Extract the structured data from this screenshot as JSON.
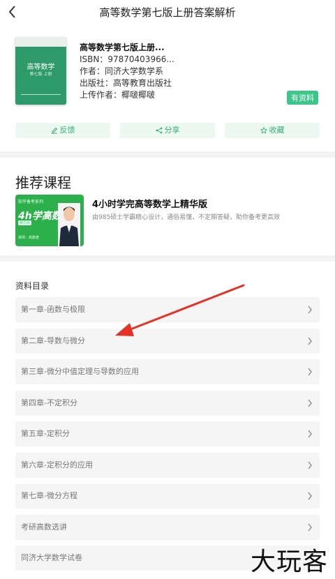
{
  "header": {
    "title": "高等数学第七版上册答案解析"
  },
  "book": {
    "cover_title": "高等数学",
    "cover_subtitle": "第七版 上册",
    "title": "高等数学第七版上册...",
    "isbn": "ISBN：97870403966...",
    "author": "作者：同济大学数学系",
    "publisher": "出版社：高等教育出版社",
    "uploader": "上传作者：椰啵椰啵",
    "badge": "有资料"
  },
  "actions": [
    {
      "label": "反馈",
      "icon": "edit-icon"
    },
    {
      "label": "分享",
      "icon": "share-icon"
    },
    {
      "label": "收藏",
      "icon": "star-icon"
    }
  ],
  "recommend": {
    "section_title": "推荐课程",
    "course_title": "4小时学完高等数学上精华版",
    "course_desc": "由985硕士学霸精心设计，通俗易懂，不定期答疑，助你备考更高效",
    "thumb_top": "知乎备考系列",
    "thumb_main": "4h学高数",
    "thumb_tag": "精华版",
    "thumb_teacher": "讲师：高数老"
  },
  "toc": {
    "title": "资料目录",
    "items": [
      "第一章-函数与极限",
      "第二章-导数与微分",
      "第三章-微分中值定理与导数的应用",
      "第四章-不定积分",
      "第五章-定积分",
      "第六章-定积分的应用",
      "第七章-微分方程",
      "考研高数选讲",
      "同济大学数学试卷"
    ]
  },
  "watermark": "大玩客",
  "colors": {
    "accent": "#3cc68a",
    "arrow": "#e53226"
  }
}
